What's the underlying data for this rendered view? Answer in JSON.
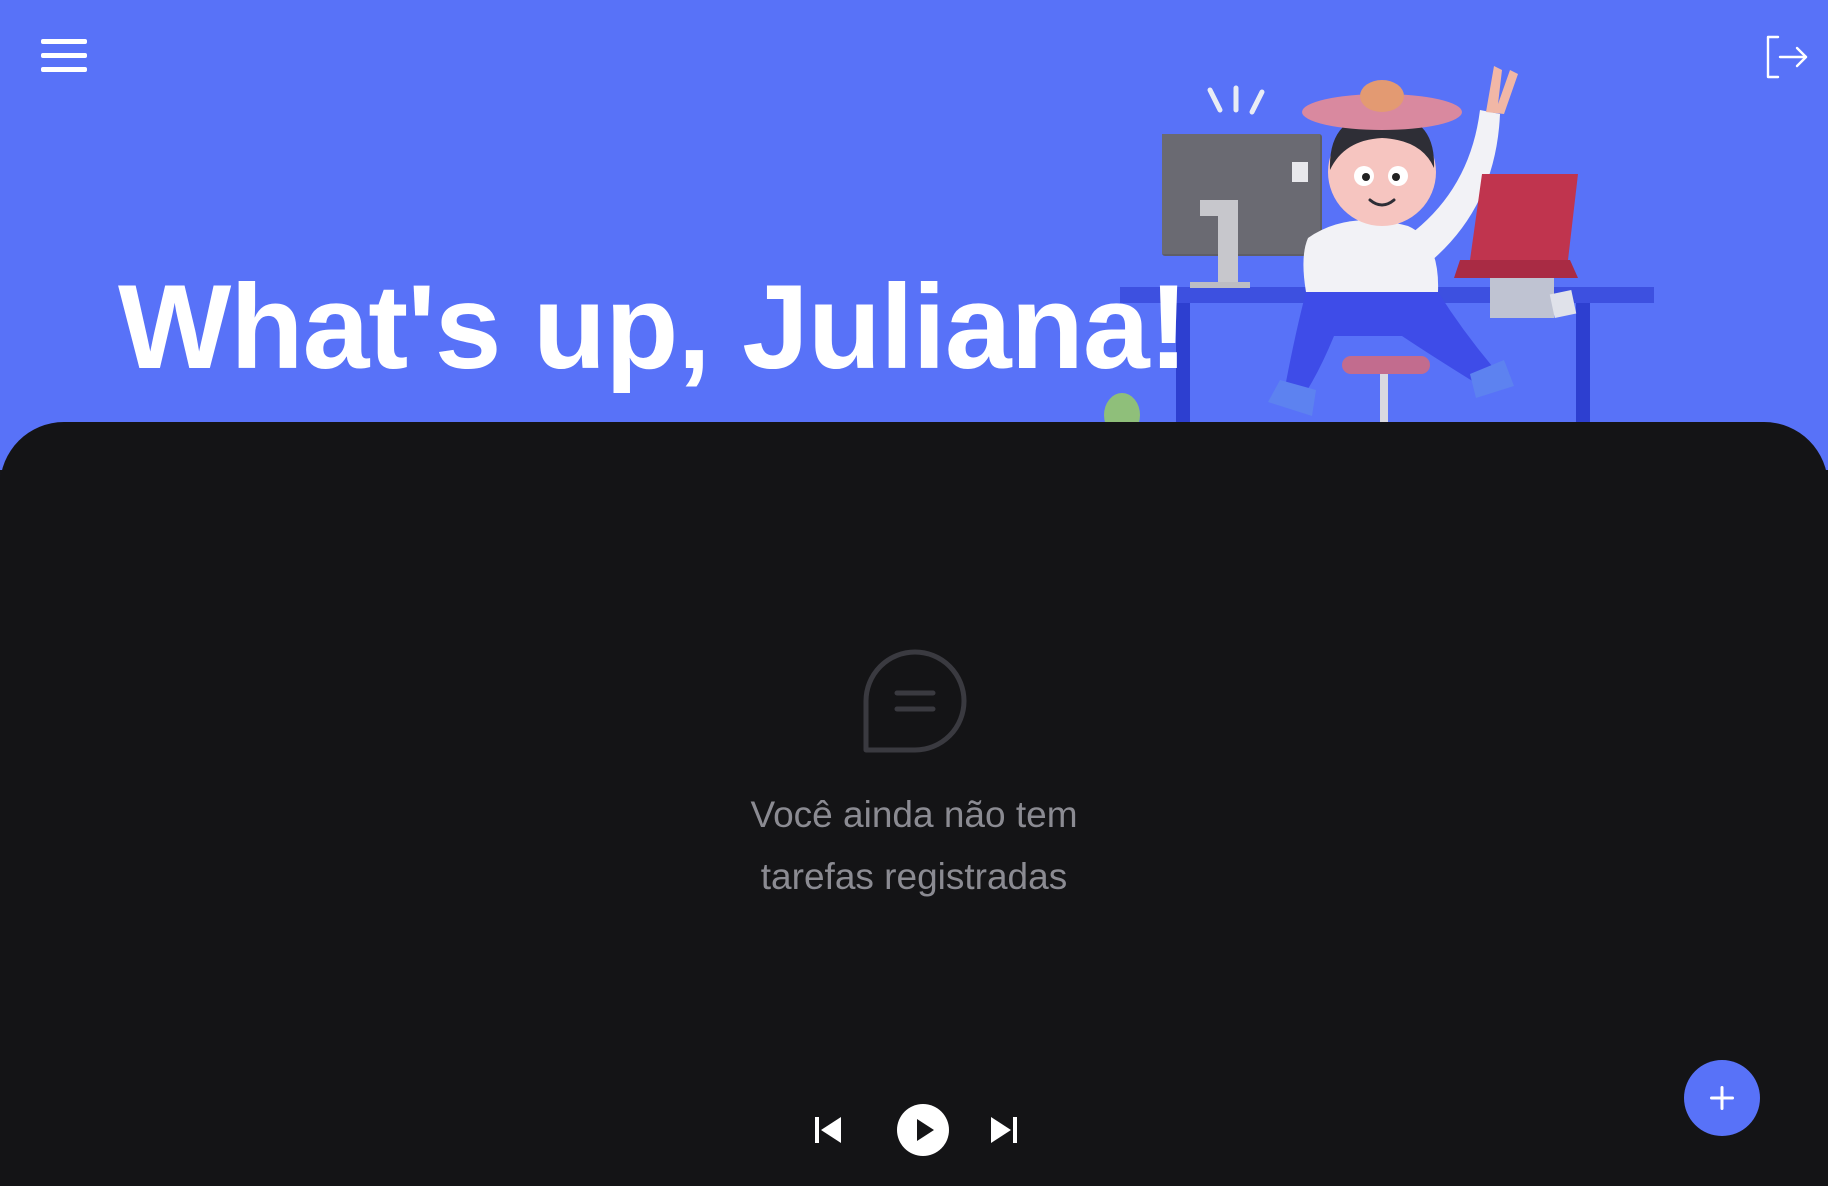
{
  "header": {
    "greeting": "What's up, Juliana!",
    "menu_icon": "hamburger-menu-icon",
    "logout_icon": "sign-out-icon"
  },
  "illustration": {
    "name": "person-at-desk-illustration"
  },
  "empty_state": {
    "icon": "chat-bubble-icon",
    "line1": "Você ainda não tem",
    "line2": "tarefas registradas"
  },
  "player": {
    "previous_icon": "skip-previous-icon",
    "play_icon": "play-icon",
    "next_icon": "skip-next-icon"
  },
  "fab": {
    "icon": "plus-icon"
  },
  "colors": {
    "accent": "#5872F8",
    "background": "#141416",
    "muted_text": "#8B8B92",
    "icon_muted": "#3A3A40"
  }
}
